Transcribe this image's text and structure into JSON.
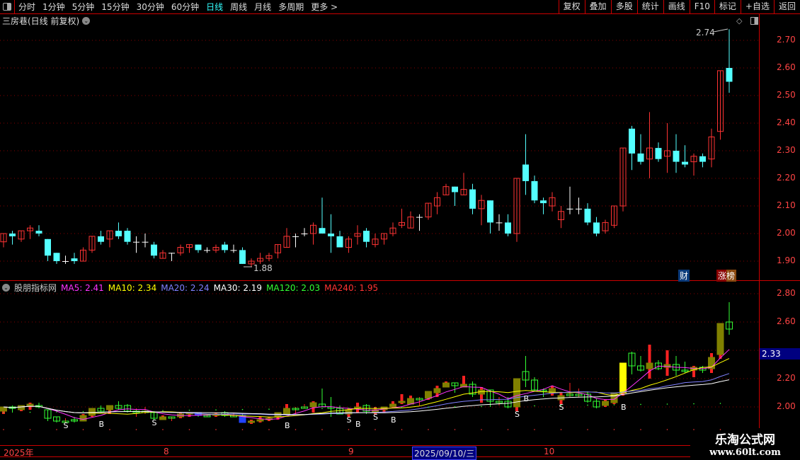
{
  "toolbar": {
    "periods": [
      "分时",
      "1分钟",
      "5分钟",
      "15分钟",
      "30分钟",
      "60分钟",
      "日线",
      "周线",
      "月线",
      "多周期",
      "更多 >"
    ],
    "active_period": "日线",
    "buttons": [
      "复权",
      "叠加",
      "多股",
      "统计",
      "画线",
      "F10",
      "标记",
      "+自选",
      "返回"
    ]
  },
  "main_title": "三房巷(日线 前复权)",
  "indicator": {
    "name": "股朋指标网",
    "ma": [
      {
        "label": "MA5: 2.41",
        "color": "#ff33ff"
      },
      {
        "label": "MA10: 2.34",
        "color": "#ffff00"
      },
      {
        "label": "MA20: 2.24",
        "color": "#8080ff"
      },
      {
        "label": "MA30: 2.19",
        "color": "#ffffff"
      },
      {
        "label": "MA120: 2.03",
        "color": "#33ff33"
      },
      {
        "label": "MA240: 1.95",
        "color": "#ff3333"
      }
    ],
    "current_value": "2.33",
    "axis_ticks": [
      "2.80",
      "2.60",
      "2.20",
      "2.00"
    ]
  },
  "badges": {
    "cai": "财",
    "zhangbang": "涨榜"
  },
  "annotations": {
    "high": "2.74",
    "low": "1.88"
  },
  "time_axis": {
    "labels": [
      "2025年",
      "8",
      "9",
      "10"
    ],
    "cursor_date": "2025/09/10/三"
  },
  "watermark": {
    "name": "乐淘公式网",
    "url": "www.60lt.com"
  },
  "chart_data": {
    "type": "candlestick",
    "y_ticks": [
      "2.70",
      "2.60",
      "2.50",
      "2.40",
      "2.30",
      "2.20",
      "2.10",
      "2.00",
      "1.90"
    ],
    "ylim": [
      1.87,
      2.75
    ],
    "colors": {
      "up": "#ff3333",
      "down": "#54ffff",
      "flat": "#ffffff"
    },
    "ohlc": [
      [
        1.97,
        2.0,
        1.95,
        2.0
      ],
      [
        2.0,
        2.01,
        1.96,
        1.99
      ],
      [
        1.98,
        2.01,
        1.97,
        2.01
      ],
      [
        2.01,
        2.03,
        1.98,
        2.02
      ],
      [
        2.01,
        2.03,
        1.99,
        2.0
      ],
      [
        1.98,
        1.98,
        1.9,
        1.92
      ],
      [
        1.93,
        1.93,
        1.89,
        1.9
      ],
      [
        1.9,
        1.92,
        1.89,
        1.9
      ],
      [
        1.91,
        1.93,
        1.89,
        1.9
      ],
      [
        1.9,
        1.95,
        1.9,
        1.94
      ],
      [
        1.94,
        1.99,
        1.93,
        1.99
      ],
      [
        1.99,
        2.01,
        1.96,
        1.97
      ],
      [
        1.98,
        2.01,
        1.95,
        2.01
      ],
      [
        2.01,
        2.04,
        1.98,
        1.99
      ],
      [
        2.01,
        2.02,
        1.96,
        1.97
      ],
      [
        1.97,
        1.99,
        1.93,
        1.97
      ],
      [
        1.97,
        2.0,
        1.95,
        1.97
      ],
      [
        1.96,
        1.97,
        1.91,
        1.92
      ],
      [
        1.91,
        1.94,
        1.91,
        1.93
      ],
      [
        1.93,
        1.93,
        1.9,
        1.93
      ],
      [
        1.93,
        1.96,
        1.92,
        1.95
      ],
      [
        1.95,
        1.96,
        1.93,
        1.96
      ],
      [
        1.96,
        1.96,
        1.93,
        1.94
      ],
      [
        1.94,
        1.95,
        1.93,
        1.94
      ],
      [
        1.94,
        1.96,
        1.93,
        1.95
      ],
      [
        1.96,
        1.97,
        1.93,
        1.94
      ],
      [
        1.94,
        1.96,
        1.93,
        1.94
      ],
      [
        1.94,
        1.95,
        1.89,
        1.89
      ],
      [
        1.89,
        1.91,
        1.88,
        1.9
      ],
      [
        1.9,
        1.93,
        1.89,
        1.91
      ],
      [
        1.91,
        1.93,
        1.9,
        1.92
      ],
      [
        1.93,
        1.96,
        1.91,
        1.96
      ],
      [
        1.95,
        2.02,
        1.95,
        1.99
      ],
      [
        1.99,
        2.0,
        1.95,
        1.99
      ],
      [
        2.0,
        2.02,
        1.99,
        2.0
      ],
      [
        2.0,
        2.04,
        1.96,
        2.03
      ],
      [
        2.02,
        2.13,
        2.0,
        2.0
      ],
      [
        2.0,
        2.07,
        1.93,
        1.99
      ],
      [
        1.99,
        2.01,
        1.95,
        1.95
      ],
      [
        1.95,
        1.99,
        1.93,
        1.98
      ],
      [
        1.99,
        2.03,
        1.96,
        2.0
      ],
      [
        2.01,
        2.02,
        1.95,
        1.97
      ],
      [
        1.96,
        2.0,
        1.95,
        1.98
      ],
      [
        1.98,
        2.0,
        1.96,
        2.0
      ],
      [
        2.0,
        2.04,
        1.99,
        2.02
      ],
      [
        2.03,
        2.09,
        2.02,
        2.04
      ],
      [
        2.02,
        2.08,
        2.02,
        2.06
      ],
      [
        2.06,
        2.07,
        2.01,
        2.06
      ],
      [
        2.06,
        2.11,
        2.05,
        2.11
      ],
      [
        2.1,
        2.15,
        2.07,
        2.13
      ],
      [
        2.14,
        2.18,
        2.14,
        2.17
      ],
      [
        2.17,
        2.17,
        2.1,
        2.15
      ],
      [
        2.14,
        2.22,
        2.14,
        2.16
      ],
      [
        2.16,
        2.18,
        2.07,
        2.09
      ],
      [
        2.09,
        2.14,
        2.03,
        2.12
      ],
      [
        2.12,
        2.12,
        2.0,
        2.04
      ],
      [
        2.04,
        2.07,
        2.01,
        2.04
      ],
      [
        2.04,
        2.07,
        1.99,
        2.0
      ],
      [
        2.0,
        2.2,
        1.97,
        2.2
      ],
      [
        2.25,
        2.36,
        2.14,
        2.19
      ],
      [
        2.19,
        2.21,
        2.11,
        2.12
      ],
      [
        2.12,
        2.13,
        2.07,
        2.11
      ],
      [
        2.1,
        2.15,
        2.08,
        2.13
      ],
      [
        2.05,
        2.1,
        2.02,
        2.08
      ],
      [
        2.09,
        2.17,
        2.07,
        2.09
      ],
      [
        2.09,
        2.13,
        2.07,
        2.09
      ],
      [
        2.09,
        2.11,
        2.03,
        2.04
      ],
      [
        2.04,
        2.06,
        1.99,
        2.0
      ],
      [
        2.01,
        2.05,
        2.0,
        2.04
      ],
      [
        2.03,
        2.1,
        2.02,
        2.1
      ],
      [
        2.1,
        2.31,
        2.08,
        2.31
      ],
      [
        2.38,
        2.39,
        2.23,
        2.29
      ],
      [
        2.29,
        2.36,
        2.25,
        2.26
      ],
      [
        2.27,
        2.44,
        2.2,
        2.31
      ],
      [
        2.31,
        2.33,
        2.26,
        2.27
      ],
      [
        2.28,
        2.4,
        2.22,
        2.3
      ],
      [
        2.3,
        2.36,
        2.22,
        2.26
      ],
      [
        2.26,
        2.32,
        2.24,
        2.25
      ],
      [
        2.26,
        2.29,
        2.21,
        2.28
      ],
      [
        2.28,
        2.29,
        2.24,
        2.26
      ],
      [
        2.27,
        2.38,
        2.24,
        2.35
      ],
      [
        2.37,
        2.59,
        2.34,
        2.59
      ],
      [
        2.6,
        2.74,
        2.51,
        2.55
      ]
    ],
    "signals": [
      {
        "i": 7,
        "label": "S"
      },
      {
        "i": 11,
        "label": "B"
      },
      {
        "i": 17,
        "label": "S"
      },
      {
        "i": 32,
        "label": "B"
      },
      {
        "i": 39,
        "label": "S"
      },
      {
        "i": 40,
        "label": "B"
      },
      {
        "i": 42,
        "label": "S"
      },
      {
        "i": 44,
        "label": "B"
      },
      {
        "i": 58,
        "label": "S"
      },
      {
        "i": 59,
        "label": "B"
      },
      {
        "i": 63,
        "label": "S"
      },
      {
        "i": 70,
        "label": "B"
      }
    ]
  }
}
